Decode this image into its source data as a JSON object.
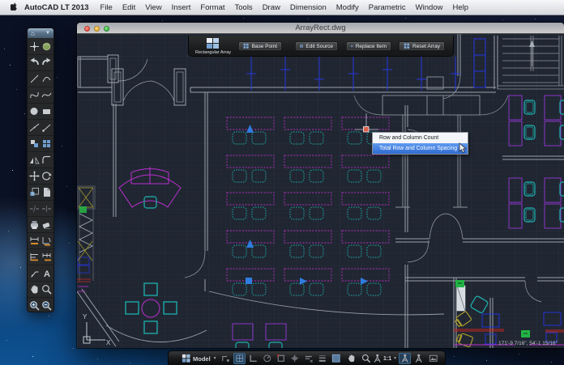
{
  "menu_bar": {
    "apple_icon": "apple-icon",
    "items": [
      "AutoCAD LT 2013",
      "File",
      "Edit",
      "View",
      "Insert",
      "Format",
      "Tools",
      "Draw",
      "Dimension",
      "Modify",
      "Parametric",
      "Window",
      "Help"
    ]
  },
  "window": {
    "title": "ArrayRect.dwg"
  },
  "ribbon": {
    "tool_label": "Rectangular Array",
    "buttons": [
      {
        "label": "Base Point",
        "icon": "base-point-icon"
      },
      {
        "label": "Edit Source",
        "icon": "edit-source-icon"
      },
      {
        "label": "Replace Item",
        "icon": "replace-item-icon"
      },
      {
        "label": "Reset Array",
        "icon": "reset-array-icon"
      }
    ]
  },
  "popup": {
    "items": [
      "Row and Column Count",
      "Total Row and Column Spacing"
    ],
    "selected_index": 1
  },
  "canvas": {
    "coordinate_readout": "171'-9 7/16\", 54'-1 15/16\"",
    "ucs_x": "X",
    "ucs_y": "Y"
  },
  "palette": {
    "header_icon": "home-icon",
    "tools": [
      [
        "selection",
        "sphere"
      ],
      [
        "undo",
        "redo"
      ],
      [
        "line",
        "arc"
      ],
      [
        "polyline",
        "spline"
      ],
      [
        "circle",
        "rectangle"
      ],
      [
        "construction-line",
        "ray"
      ],
      [
        "copy",
        "array"
      ],
      [
        "mirror",
        "fillet"
      ],
      [
        "move",
        "rotate"
      ],
      [
        "scale",
        "trim"
      ],
      [
        "break",
        "break-at-point"
      ],
      [
        "print",
        "erase"
      ],
      [
        "dim-linear",
        "dim-angular"
      ],
      [
        "dim-baseline",
        "dim-continue"
      ],
      [
        "leader",
        "text"
      ],
      [
        "pan",
        "zoom"
      ],
      [
        "zoom-in",
        "zoom-out"
      ]
    ]
  },
  "status_bar": {
    "model_space_icon": "grid2",
    "model_label": "Model",
    "toggles": [
      "snap",
      "grid",
      "ortho",
      "polar",
      "osnap",
      "otrack",
      "dyn",
      "lineweight",
      "quickview"
    ],
    "nav_icons": [
      "pan",
      "zoom"
    ],
    "annotation_icons_left": "person",
    "scale_label": "1:1",
    "annotation_icons": [
      "person",
      "person-hl",
      "person2",
      "image"
    ]
  }
}
